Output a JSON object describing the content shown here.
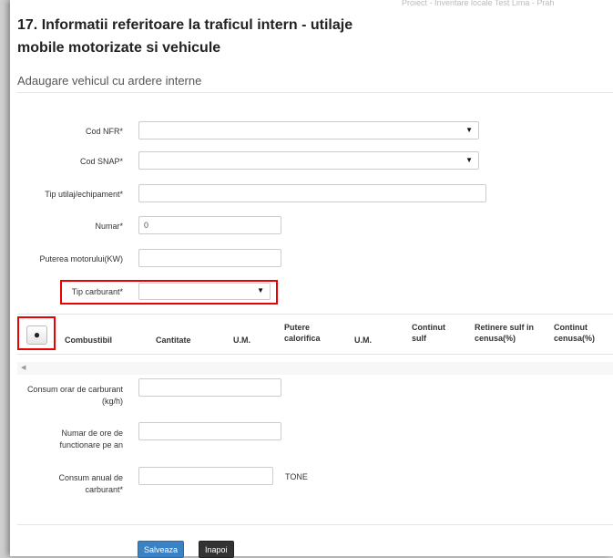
{
  "top_fragment": "Proiect - Inventare locale Test Lima - Prah",
  "title_line1": "17. Informatii referitoare la traficul intern - utilaje",
  "title_line2": "mobile motorizate si vehicule",
  "subtitle": "Adaugare vehicul cu ardere interne",
  "form": {
    "cod_nfr": {
      "label": "Cod NFR*",
      "value": ""
    },
    "cod_snap": {
      "label": "Cod SNAP*",
      "value": ""
    },
    "tip_utilaj": {
      "label": "Tip utilaj/echipament*",
      "value": ""
    },
    "numar": {
      "label": "Numar*",
      "value": "0"
    },
    "puterea": {
      "label": "Puterea motorului(KW)",
      "value": ""
    },
    "tip_carburant": {
      "label": "Tip carburant*",
      "value": ""
    }
  },
  "table": {
    "add_icon": "plus-circle-icon",
    "columns": [
      "Combustibil",
      "Cantitate",
      "U.M.",
      "Putere calorifica",
      "U.M.",
      "Continut sulf",
      "Retinere sulf in cenusa(%)",
      "Continut cenusa(%)"
    ]
  },
  "consum_orar": {
    "label": "Consum orar de carburant (kg/h)",
    "value": ""
  },
  "numar_ore": {
    "label": "Numar de ore de functionare pe an",
    "value": ""
  },
  "consum_anual": {
    "label": "Consum anual de carburant*",
    "value": "",
    "unit": "TONE"
  },
  "buttons": {
    "save": "Salveaza",
    "back": "Inapoi"
  },
  "colors": {
    "highlight": "#e00000",
    "primary": "#3a82c4"
  }
}
